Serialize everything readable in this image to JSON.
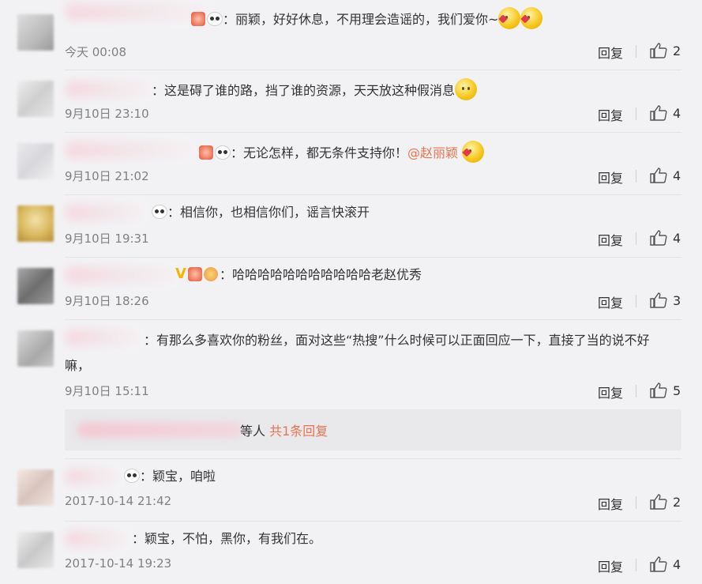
{
  "comments": [
    {
      "text": "：丽颖，好好休息，不用理会造谣的，我们爱你~",
      "time": "今天 00:08",
      "likes": "2"
    },
    {
      "text": "：这是碍了谁的路，挡了谁的资源，天天放这种假消息",
      "time": "9月10日 23:10",
      "likes": "4"
    },
    {
      "text": "：无论怎样，都无条件支持你！",
      "mention": "@赵丽颖",
      "time": "9月10日 21:02",
      "likes": "4"
    },
    {
      "text": "：相信你，也相信你们，谣言快滚开",
      "time": "9月10日 19:31",
      "likes": "4"
    },
    {
      "text": "：哈哈哈哈哈哈哈哈哈哈哈老赵优秀",
      "time": "9月10日 18:26",
      "likes": "3"
    },
    {
      "text": "：有那么多喜欢你的粉丝，面对这些“热搜”什么时候可以正面回应一下，直接了当的说不好嘛，",
      "time": "9月10日 15:11",
      "likes": "5"
    },
    {
      "text": "：颖宝，咱啦",
      "time": "2017-10-14 21:42",
      "likes": "2"
    },
    {
      "text": "：颖宝，不怕，黑你，有我们在。",
      "time": "2017-10-14 19:23",
      "likes": "4"
    }
  ],
  "reply_label": "回复",
  "replies_summary": {
    "prefix": "等人",
    "count": "共1条回复"
  },
  "icons": {
    "like": "thumbs-up-icon",
    "emoji": "smiley-emoji-icon",
    "panda": "panda-icon"
  },
  "colors": {
    "accent": "#eb7350",
    "background": "#f2f2f5"
  }
}
